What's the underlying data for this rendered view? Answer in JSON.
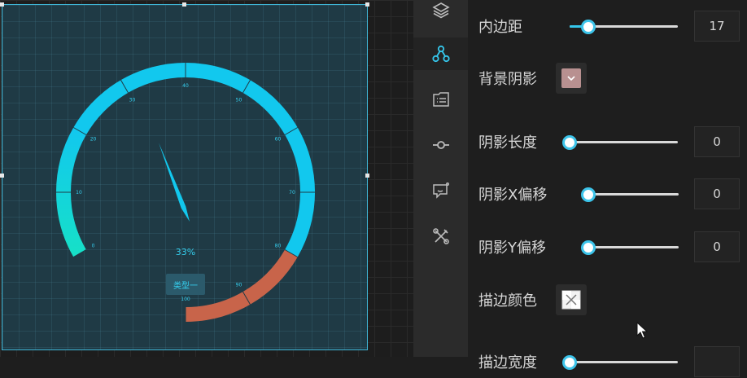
{
  "canvas": {
    "gauge": {
      "percent_text": "33%",
      "type_button_label": "类型一",
      "value_percent": 33,
      "ticks": [
        "0",
        "10",
        "20",
        "30",
        "40",
        "50",
        "60",
        "70",
        "80",
        "90",
        "100"
      ],
      "colors": {
        "low_gradient_start": "#16e0c8",
        "main_arc": "#12c8ee",
        "high_segment": "#c8644a",
        "pointer": "#12c8ee",
        "panel_background": "#1f3a45"
      }
    }
  },
  "sidebar": {
    "icons": [
      "layers-icon",
      "nodes-icon",
      "list-card-icon",
      "commit-icon",
      "chat-icon",
      "tools-icon"
    ],
    "active_index": 1
  },
  "properties": {
    "padding": {
      "label": "内边距",
      "value": "17",
      "slider_fraction": 0.17
    },
    "background_shadow": {
      "label": "背景阴影",
      "swatch_color": "#b89090"
    },
    "shadow_length": {
      "label": "阴影长度",
      "value": "0",
      "slider_fraction": 0
    },
    "shadow_x_offset": {
      "label": "阴影X偏移",
      "value": "0",
      "slider_fraction": 0
    },
    "shadow_y_offset": {
      "label": "阴影Y偏移",
      "value": "0",
      "slider_fraction": 0
    },
    "stroke_color": {
      "label": "描边颜色"
    },
    "stroke_width": {
      "label": "描边宽度"
    }
  },
  "accent_color": "#35c7ec"
}
